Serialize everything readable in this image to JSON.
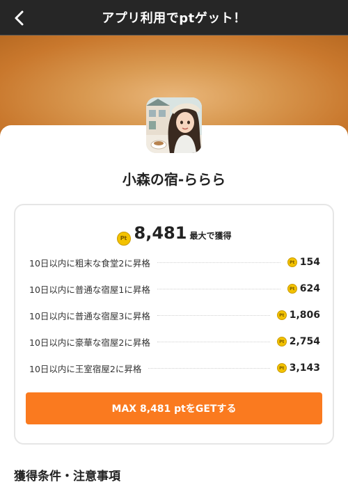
{
  "header": {
    "title": "アプリ利用でptゲット！"
  },
  "app": {
    "name": "小森の宿-ららら"
  },
  "summary": {
    "total": "8,481",
    "suffix": "最大で獲得",
    "coin_text": "Pt"
  },
  "tasks": [
    {
      "label": "10日以内に粗末な食堂2に昇格",
      "points": "154"
    },
    {
      "label": "10日以内に普通な宿屋1に昇格",
      "points": "624"
    },
    {
      "label": "10日以内に普通な宿屋3に昇格",
      "points": "1,806"
    },
    {
      "label": "10日以内に豪華な宿屋2に昇格",
      "points": "2,754"
    },
    {
      "label": "10日以内に王室宿屋2に昇格",
      "points": "3,143"
    }
  ],
  "cta": {
    "label": "MAX 8,481 ptをGETする"
  },
  "section": {
    "title": "獲得条件・注意事項"
  },
  "colors": {
    "accent": "#fa7a1f",
    "header_bg": "#262626",
    "coin": "#f3c200"
  },
  "icons": {
    "back": "chevron-left-icon",
    "coin": "pt-coin-icon"
  }
}
